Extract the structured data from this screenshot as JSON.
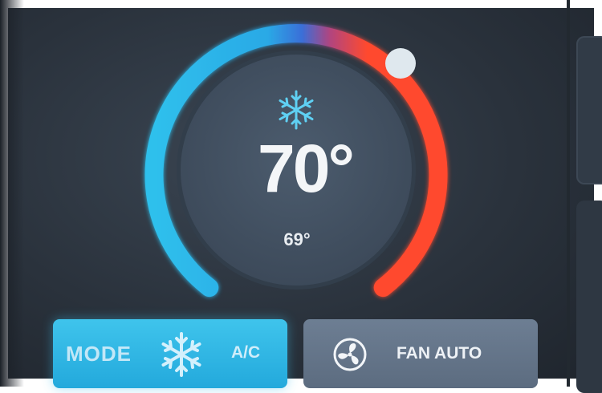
{
  "thermostat": {
    "setpoint": "70°",
    "current": "69°",
    "mode_icon": "snowflake-icon"
  },
  "mode_button": {
    "label": "MODE",
    "value": "A/C",
    "icon": "snowflake-icon"
  },
  "fan_button": {
    "label": "FAN AUTO",
    "icon": "fan-icon"
  },
  "colors": {
    "cool": "#2fc0ec",
    "heat": "#ff4a2e",
    "mode_button_bg": "#2db5e3",
    "fan_button_bg": "#64758a",
    "screen_bg": "#2e3640"
  }
}
